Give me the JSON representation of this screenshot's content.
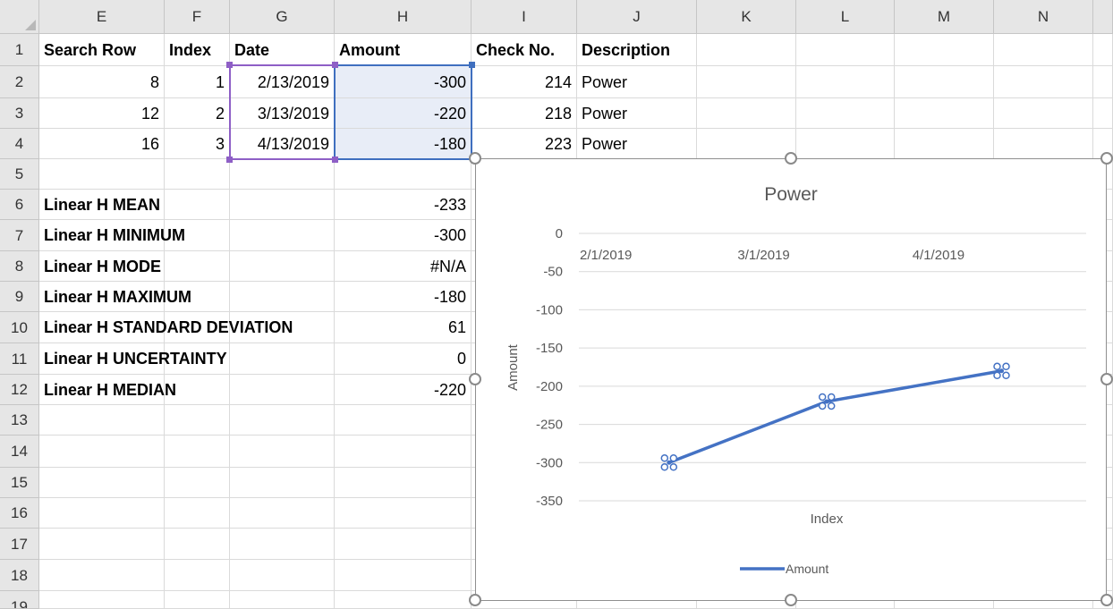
{
  "columns": [
    "E",
    "F",
    "G",
    "H",
    "I",
    "J",
    "K",
    "L",
    "M",
    "N"
  ],
  "rows": [
    "1",
    "2",
    "3",
    "4",
    "5",
    "6",
    "7",
    "8",
    "9",
    "10",
    "11",
    "12",
    "13",
    "14",
    "15",
    "16",
    "17",
    "18",
    "19"
  ],
  "headers": {
    "search_row": "Search Row",
    "index": "Index",
    "date": "Date",
    "amount": "Amount",
    "check_no": "Check No.",
    "description": "Description"
  },
  "data_rows": [
    {
      "search_row": "8",
      "index": "1",
      "date": "2/13/2019",
      "amount": "-300",
      "check_no": "214",
      "description": "Power"
    },
    {
      "search_row": "12",
      "index": "2",
      "date": "3/13/2019",
      "amount": "-220",
      "check_no": "218",
      "description": "Power"
    },
    {
      "search_row": "16",
      "index": "3",
      "date": "4/13/2019",
      "amount": "-180",
      "check_no": "223",
      "description": "Power"
    }
  ],
  "stats": [
    {
      "label": "Linear H MEAN",
      "value": "-233"
    },
    {
      "label": "Linear H MINIMUM",
      "value": "-300"
    },
    {
      "label": "Linear H MODE",
      "value": "#N/A"
    },
    {
      "label": "Linear H MAXIMUM",
      "value": "-180"
    },
    {
      "label": "Linear H STANDARD DEVIATION",
      "value": "61"
    },
    {
      "label": "Linear H UNCERTAINTY",
      "value": "0"
    },
    {
      "label": "Linear H MEDIAN",
      "value": "-220"
    }
  ],
  "colors": {
    "series": "#4472c4",
    "selection_purple": "#8e5fc6",
    "selection_blue": "#3f6fbf"
  },
  "chart_data": {
    "type": "line",
    "title": "Power",
    "xlabel": "Index",
    "ylabel": "Amount",
    "x_tick_labels": [
      "2/1/2019",
      "3/1/2019",
      "4/1/2019"
    ],
    "y_ticks": [
      0,
      -50,
      -100,
      -150,
      -200,
      -250,
      -300,
      -350
    ],
    "ylim": [
      -350,
      0
    ],
    "legend_position": "bottom",
    "series": [
      {
        "name": "Amount",
        "x": [
          "2/13/2019",
          "3/13/2019",
          "4/13/2019"
        ],
        "values": [
          -300,
          -220,
          -180
        ]
      }
    ]
  }
}
